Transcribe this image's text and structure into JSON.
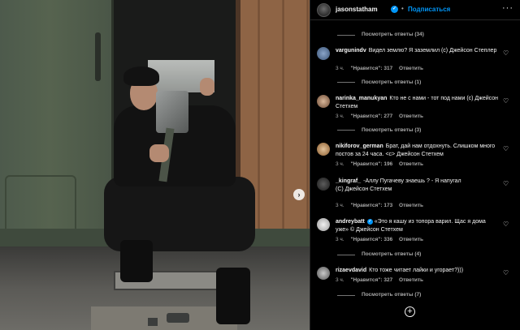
{
  "header": {
    "username": "jasonstatham",
    "separator": "•",
    "follow_label": "Подписаться",
    "more_icon": "more-horizontal-icon"
  },
  "photo": {
    "next_icon": "chevron-right-icon"
  },
  "thread": {
    "top_view_replies": "Посмотреть ответы (34)",
    "comments": [
      {
        "username": "vargunindv",
        "verified": false,
        "text": "Видел землю? Я заземлил (с) Джейсон Степлер",
        "time": "3 ч.",
        "likes": "\"Нравится\": 317",
        "reply": "Ответить",
        "view_replies": "Посмотреть ответы (1)"
      },
      {
        "username": "narinka_manukyan",
        "verified": false,
        "text": "Кто не с нами - тот под нами (с) Джейсон Стетхем",
        "time": "3 ч.",
        "likes": "\"Нравится\": 277",
        "reply": "Ответить",
        "view_replies": "Посмотреть ответы (3)"
      },
      {
        "username": "nikiforov_german",
        "verified": false,
        "text": "Брат, дай нам отдохнуть. Слишком много постов за 24 часа. <с> Джейсон Стетхем",
        "time": "3 ч.",
        "likes": "\"Нравится\": 196",
        "reply": "Ответить",
        "view_replies": ""
      },
      {
        "username": "_kingraf_",
        "verified": false,
        "text": "-Аллу Пугачеву знаешь ? - Я напугал (С) Джейсон Стетхем",
        "time": "3 ч.",
        "likes": "\"Нравится\": 173",
        "reply": "Ответить",
        "view_replies": ""
      },
      {
        "username": "andreybatt",
        "verified": true,
        "text": "«Это я кашу из топора варил. Щас я дома уже» © Джейсон Стетхем",
        "time": "3 ч.",
        "likes": "\"Нравится\": 336",
        "reply": "Ответить",
        "view_replies": "Посмотреть ответы (4)"
      },
      {
        "username": "rizaevdavid",
        "verified": false,
        "text": "Кто тоже читает лайки и угорает?)))",
        "time": "3 ч.",
        "likes": "\"Нравится\": 327",
        "reply": "Ответить",
        "view_replies": "Посмотреть ответы (7)"
      }
    ],
    "heart_icon": "heart-icon",
    "add_icon": "plus-circle-icon"
  },
  "colors": {
    "accent": "#0095f6",
    "background": "#000000",
    "secondary_text": "#a8a8a8"
  }
}
